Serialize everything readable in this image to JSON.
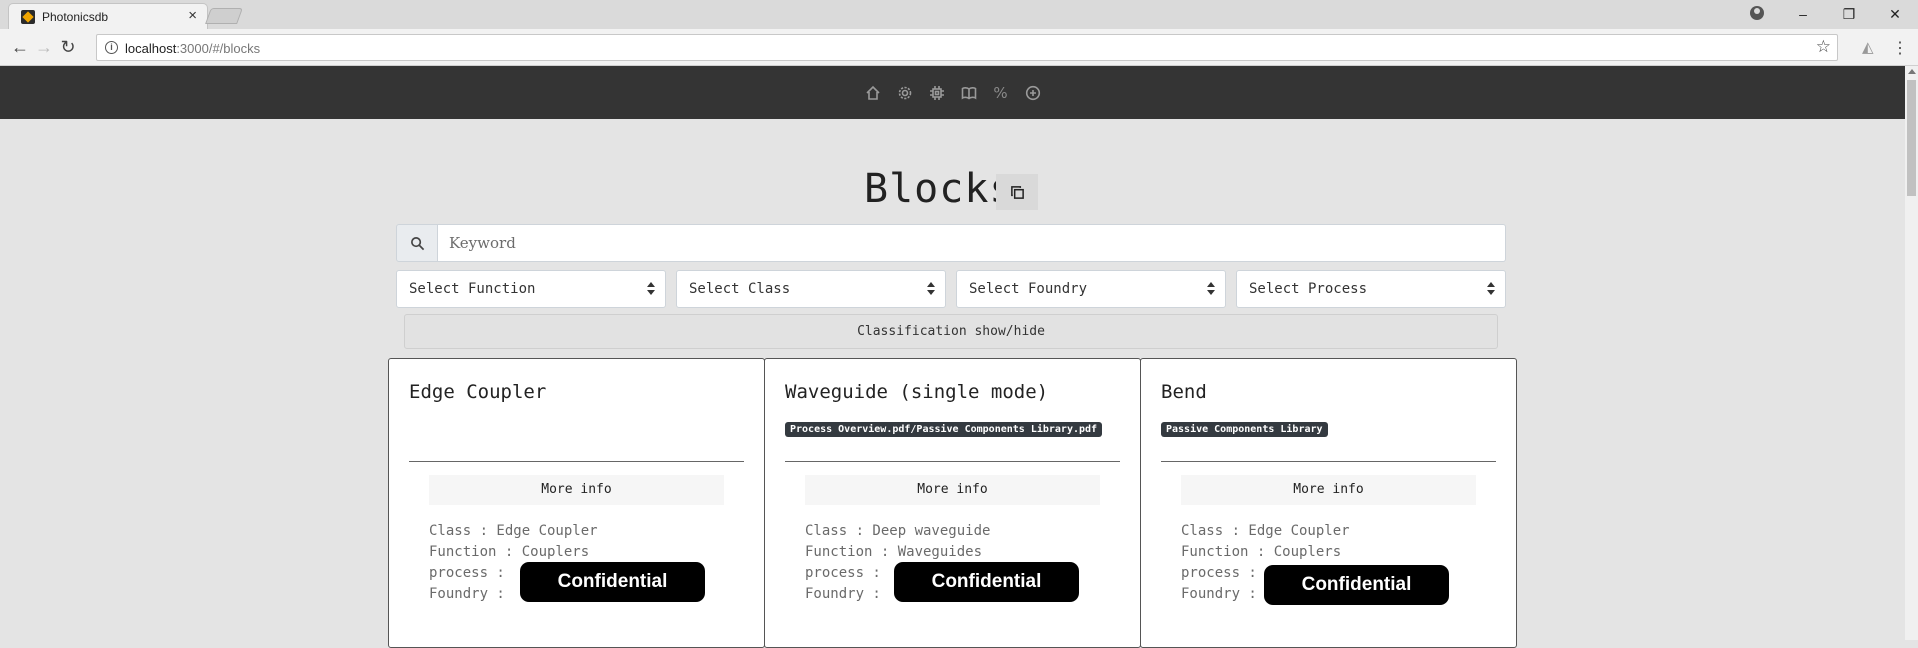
{
  "browser": {
    "tab_title": "Photonicsdb",
    "url_host": "localhost",
    "url_rest": ":3000/#/blocks"
  },
  "app_nav": {
    "icons": [
      "home-icon",
      "settings-icon",
      "chip-icon",
      "book-icon",
      "percent-icon",
      "add-icon"
    ],
    "percent_glyph": "%"
  },
  "page": {
    "title": "Blocks",
    "search_placeholder": "Keyword",
    "filters": [
      "Select Function",
      "Select Class",
      "Select Foundry",
      "Select Process"
    ],
    "classification_toggle": "Classification show/hide"
  },
  "cards": [
    {
      "title": "Edge Coupler",
      "badge": "",
      "more_info": "More info",
      "class_line": "Class : Edge Coupler",
      "function_line": "Function : Couplers",
      "process_line": "process : ",
      "foundry_line": "Foundry : ",
      "redaction": "Confidential"
    },
    {
      "title": "Waveguide (single mode)",
      "badge": "Process Overview.pdf/Passive Components Library.pdf",
      "more_info": "More info",
      "class_line": "Class : Deep waveguide",
      "function_line": "Function : Waveguides",
      "process_line": "process : ",
      "foundry_line": "Foundry : ",
      "redaction": "Confidential"
    },
    {
      "title": "Bend",
      "badge": "Passive Components Library",
      "more_info": "More info",
      "class_line": "Class : Edge Coupler",
      "function_line": "Function : Couplers",
      "process_line": "process : ",
      "foundry_line": "Foundry : ",
      "redaction": "Confidential"
    }
  ]
}
